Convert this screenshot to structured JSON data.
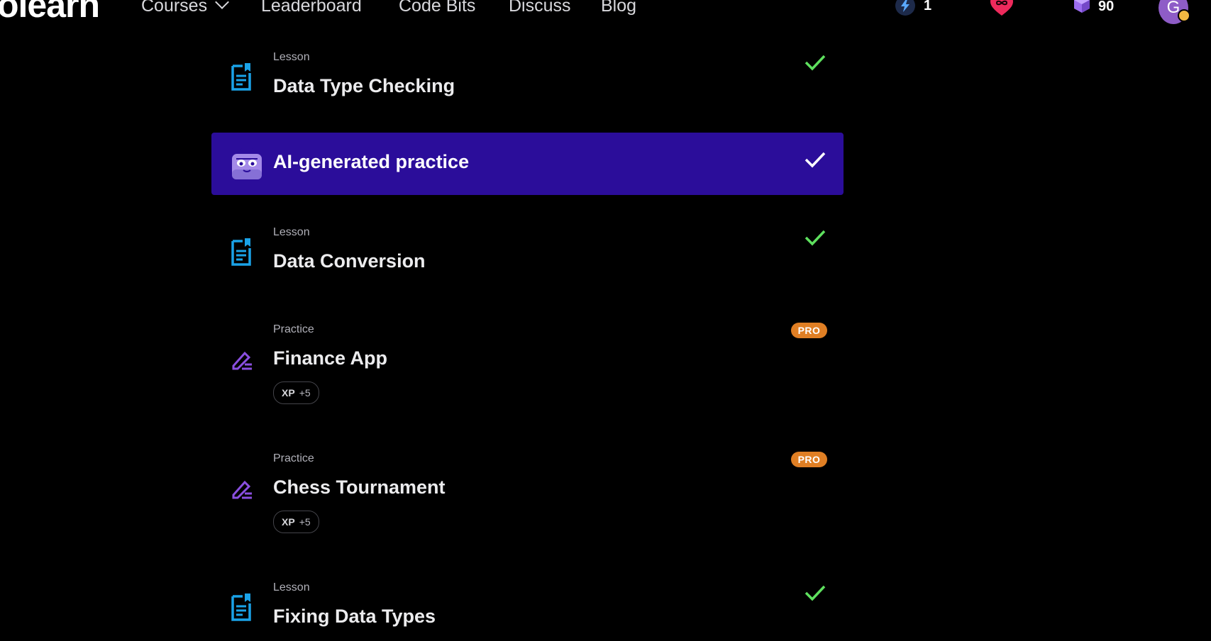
{
  "nav": {
    "logo": "olearn",
    "courses": "Courses",
    "leaderboard": "Leaderboard",
    "code_bits": "Code Bits",
    "discuss": "Discuss",
    "blog": "Blog",
    "streak_count": "1",
    "gems_count": "90",
    "avatar_initial": "G"
  },
  "colors": {
    "ai_row_bg": "#2b0d9a",
    "lesson_icon": "#1aa3e8",
    "practice_icon": "#8a4fe0",
    "check_green": "#5ee05e",
    "pro_badge": "#e07f24",
    "heart": "#ee2a5c",
    "gem": "#9c6cf0"
  },
  "items": [
    {
      "type": "Lesson",
      "title": "Data Type Checking",
      "icon": "lesson-icon",
      "completed": true
    },
    {
      "type": "",
      "title": "AI-generated practice",
      "icon": "ai-bot-icon",
      "completed": true,
      "highlighted": true
    },
    {
      "type": "Lesson",
      "title": "Data Conversion",
      "icon": "lesson-icon",
      "completed": true
    },
    {
      "type": "Practice",
      "title": "Finance App",
      "icon": "pencil-icon",
      "badge": "PRO",
      "xp_label": "XP",
      "xp_value": "+5"
    },
    {
      "type": "Practice",
      "title": "Chess Tournament",
      "icon": "pencil-icon",
      "badge": "PRO",
      "xp_label": "XP",
      "xp_value": "+5"
    },
    {
      "type": "Lesson",
      "title": "Fixing Data Types",
      "icon": "lesson-icon",
      "completed": true
    }
  ]
}
